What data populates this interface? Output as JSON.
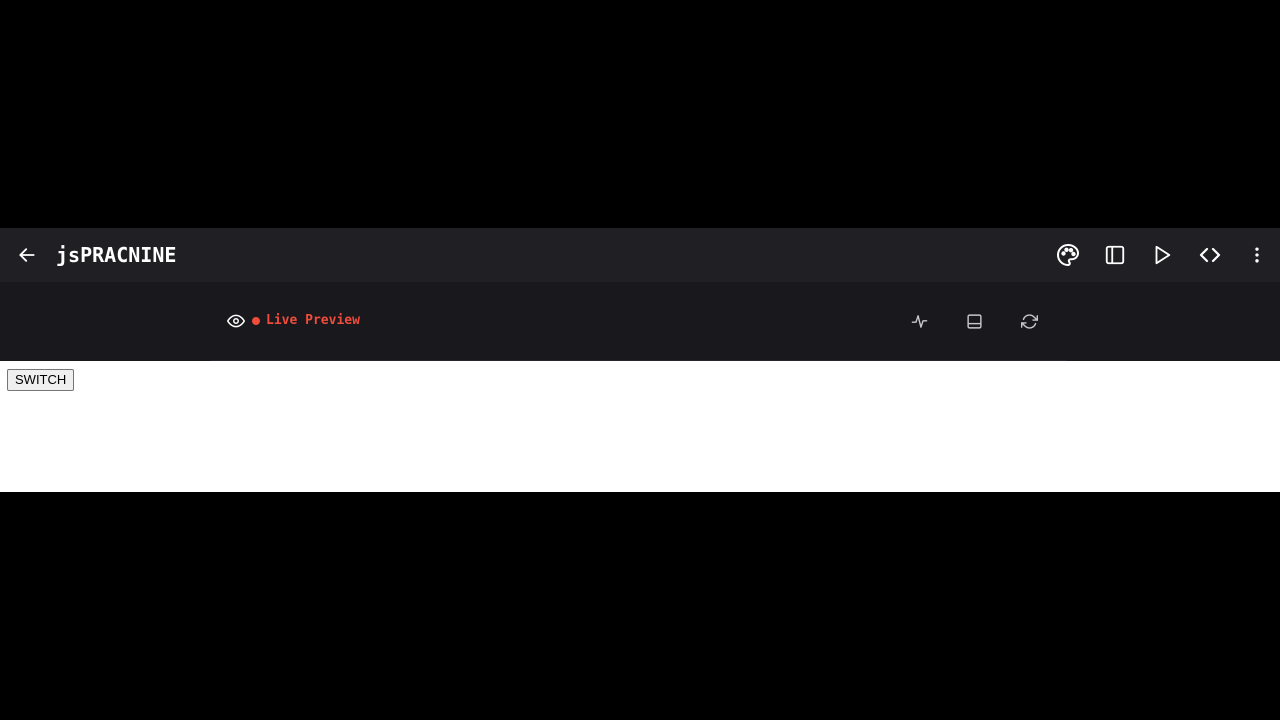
{
  "header": {
    "project_title": "jsPRACNINE",
    "icons": {
      "back": "arrow-left-icon",
      "palette": "palette-icon",
      "sidebar": "sidebar-toggle-icon",
      "run": "play-icon",
      "code": "code-icon",
      "more": "more-vertical-icon"
    }
  },
  "preview_toolbar": {
    "status_label": "Live Preview",
    "status_color": "#f04c3c",
    "icons": {
      "eye": "eye-icon",
      "activity": "activity-icon",
      "panel": "panel-bottom-icon",
      "refresh": "refresh-icon"
    }
  },
  "preview": {
    "switch_label": "SWITCH"
  },
  "colors": {
    "topbar_bg": "#1f1f24",
    "toolbar_bg": "#18181d",
    "preview_bg": "#ffffff",
    "letterbox": "#000000"
  }
}
